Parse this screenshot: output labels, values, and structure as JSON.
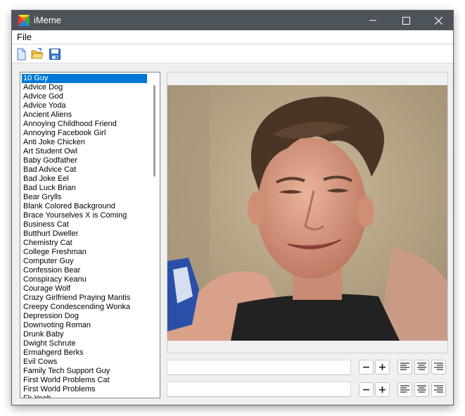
{
  "window": {
    "title": "iMeme"
  },
  "menu": {
    "file": "File"
  },
  "toolbar": {
    "icons": [
      "new-document-icon",
      "open-folder-icon",
      "save-icon"
    ]
  },
  "meme_list": {
    "selected_index": 0,
    "items": [
      "10 Guy",
      "Advice Dog",
      "Advice God",
      "Advice Yoda",
      "Ancient Aliens",
      "Annoying Childhood Friend",
      "Annoying Facebook Girl",
      "Anti Joke Chicken",
      "Art Student Owl",
      "Baby Godfather",
      "Bad Advice Cat",
      "Bad Joke Eel",
      "Bad Luck Brian",
      "Bear Grylls",
      "Blank Colored Background",
      "Brace Yourselves X is Coming",
      "Business Cat",
      "Butthurt Dweller",
      "Chemistry Cat",
      "College Freshman",
      "Computer Guy",
      "Confession Bear",
      "Conspiracy Keanu",
      "Courage Wolf",
      "Crazy Girlfriend Praying Mantis",
      "Creepy Condescending Wonka",
      "Depression Dog",
      "Downvoting Roman",
      "Drunk Baby",
      "Dwight Schrute",
      "Ermahgerd Berks",
      "Evil Cows",
      "Family Tech Support Guy",
      "First World Problems Cat",
      "First World Problems",
      "Fk Yeah"
    ]
  },
  "caption": {
    "top_text": "",
    "bottom_text": "",
    "minus": "−",
    "plus": "+"
  },
  "colors": {
    "titlebar": "#4d535a",
    "selection": "#0078d7",
    "window_bg": "#f0f0f0"
  }
}
